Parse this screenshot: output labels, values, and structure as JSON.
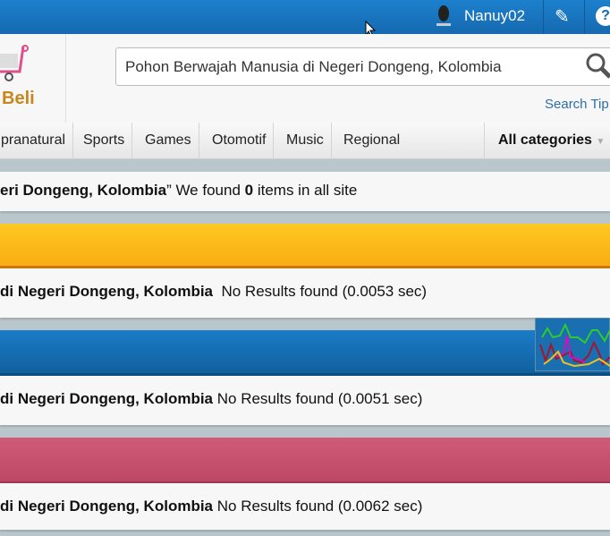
{
  "topbar": {
    "username": "Nanuy02",
    "edit_icon": "pencil-icon",
    "help_icon": "question-icon",
    "help_label": "?"
  },
  "header": {
    "brand": "Beli",
    "search_value": "Pohon Berwajah Manusia di Negeri Dongeng, Kolombia",
    "search_tips": "Search Tip"
  },
  "nav": {
    "items": [
      "pranatural",
      "Sports",
      "Games",
      "Otomotif",
      "Music",
      "Regional"
    ],
    "all_categories": "All categories"
  },
  "summary": {
    "query_tail": "eri Dongeng, Kolombia",
    "mid": "” We found ",
    "count": "0",
    "end": " items in all site"
  },
  "sections": [
    {
      "color": "#fbbd17",
      "query": "di Negeri Dongeng, Kolombia",
      "result": "  No Results found (0.0053 sec)"
    },
    {
      "color": "#1670b5",
      "query": "di Negeri Dongeng, Kolombia",
      "result": " No Results found (0.0051 sec)"
    },
    {
      "color": "#c5506e",
      "query": "di Negeri Dongeng, Kolombia",
      "result": " No Results found (0.0062 sec)"
    }
  ]
}
